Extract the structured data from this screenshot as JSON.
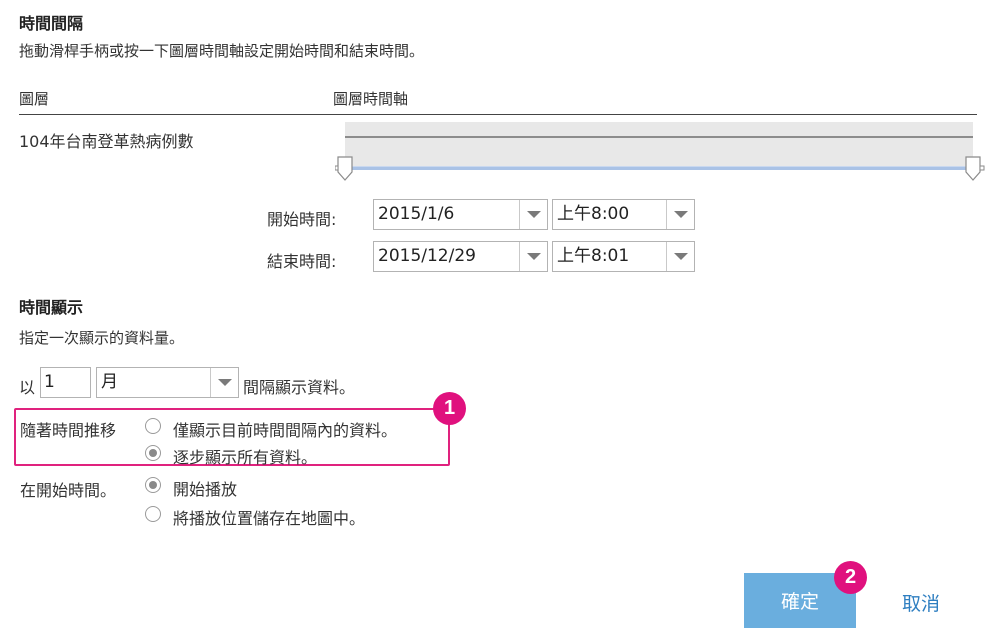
{
  "time_interval": {
    "title": "時間間隔",
    "description": "拖動滑桿手柄或按一下圖層時間軸設定開始時間和結束時間。",
    "columns": {
      "layer": "圖層",
      "timeline": "圖層時間軸"
    },
    "layer_name": "104年台南登革熱病例數",
    "start_label": "開始時間:",
    "start_date": "2015/1/6",
    "start_time": "上午8:00",
    "end_label": "結束時間:",
    "end_date": "2015/12/29",
    "end_time": "上午8:01"
  },
  "time_display": {
    "title": "時間顯示",
    "description": "指定一次顯示的資料量。",
    "prefix": "以",
    "count": "1",
    "unit": "月",
    "suffix": "間隔顯示資料。",
    "over_time_label": "隨著時間推移",
    "option_current_only": "僅顯示目前時間間隔內的資料。",
    "option_cumulative": "逐步顯示所有資料。",
    "selected_over_time": "cumulative",
    "at_start_label": "在開始時間。",
    "option_start_play": "開始播放",
    "option_save_position": "將播放位置儲存在地圖中。",
    "selected_at_start": "start_play"
  },
  "callouts": {
    "one": "1",
    "two": "2"
  },
  "buttons": {
    "ok": "確定",
    "cancel": "取消"
  },
  "colors": {
    "highlight": "#e0227e",
    "primary": "#6aaede",
    "link": "#2f7fc1"
  }
}
